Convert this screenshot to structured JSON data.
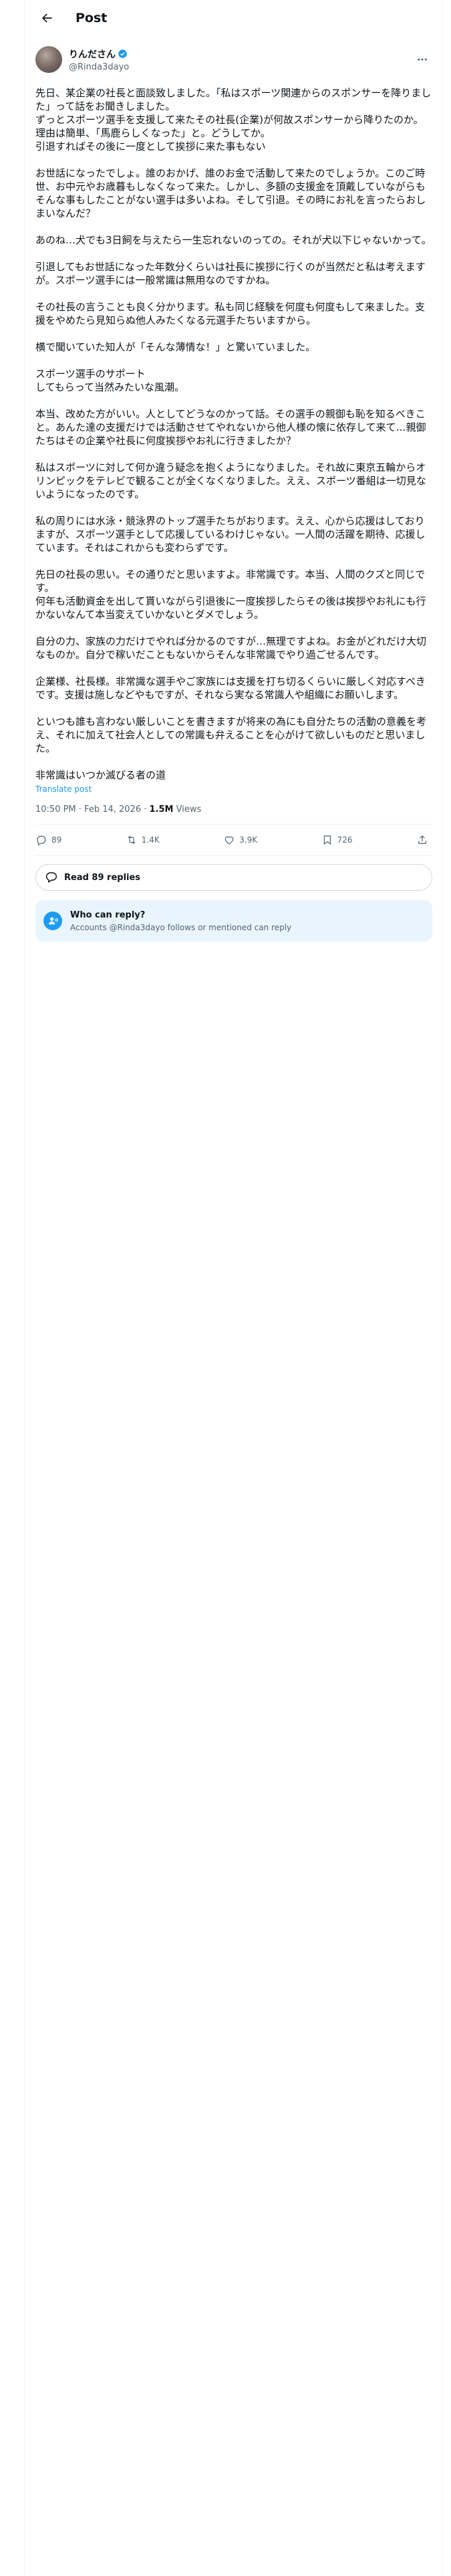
{
  "header": {
    "title": "Post"
  },
  "author": {
    "name": "りんださん",
    "handle": "@Rinda3dayo"
  },
  "post": {
    "paragraphs": [
      "先日、某企業の社長と面談致しました。「私はスポーツ関連からのスポンサーを降りました」って話をお聞きしました。\nずっとスポーツ選手を支援して来たその社長(企業)が何故スポンサーから降りたのか。理由は簡単、「馬鹿らしくなった」と。どうしてか。\n引退すればその後に一度として挨拶に来た事もない",
      "お世話になったでしょ。誰のおかげ、誰のお金で活動して来たのでしょうか。このご時世、お中元やお歳暮もしなくなって来た。しかし、多額の支援金を頂戴していながらもそんな事もしたことがない選手は多いよね。そして引退。その時にお礼を言ったらおしまいなんだ？",
      "あのね…犬でも3日飼を与えたら一生忘れないのっての。それが犬以下じゃないかって。",
      "引退してもお世話になった年数分くらいは社長に挨拶に行くのが当然だと私は考えますが。スポーツ選手には一般常識は無用なのですかね。",
      "その社長の言うことも良く分かります。私も同じ経験を何度も何度もして来ました。支援をやめたら見知らぬ他人みたくなる元選手たちいますから。",
      "横で聞いていた知人が「そんな薄情な！」と驚いていました。",
      "スポーツ選手のサポート\nしてもらって当然みたいな風潮。",
      "本当、改めた方がいい。人としてどうなのかって話。その選手の親御も恥を知るべきこと。あんた達の支援だけでは活動させてやれないから他人様の懐に依存して来て…親御たちはその企業や社長に何度挨拶やお礼に行きましたか？",
      "私はスポーツに対して何か違う疑念を抱くようになりました。それ故に東京五輪からオリンピックをテレビで観ることが全くなくなりました。ええ、スポーツ番組は一切見ないようになったのです。",
      "私の周りには水泳・競泳界のトップ選手たちがおります。ええ、心から応援はしておりますが、スポーツ選手として応援しているわけじゃない。一人間の活躍を期待、応援しています。それはこれからも変わらずです。",
      "先日の社長の思い。その通りだと思いますよ。非常識です。本当、人間のクズと同じです。\n何年も活動資金を出して貰いながら引退後に一度挨拶したらその後は挨拶やお礼にも行かないなんて本当変えていかないとダメでしょう。",
      "自分の力、家族の力だけでやれば分かるのですが…無理ですよね。お金がどれだけ大切なものか。自分で稼いだこともないからそんな非常識でやり過ごせるんです。",
      "企業様、社長様。非常識な選手やご家族には支援を打ち切るくらいに厳しく対応すべきです。支援は施しなどやもですが、それなら実なる常識人や組織にお願いします。",
      "といつも誰も言わない厳しいことを書きますが将来の為にも自分たちの活動の意義を考え、それに加えて社会人としての常識も弁えることを心がけて欲しいものだと思いました。",
      "非常識はいつか滅びる者の道"
    ],
    "translate_label": "Translate post",
    "time": "10:50 PM · Feb 14, 2026",
    "views_count": "1.5M",
    "views_label": "Views"
  },
  "actions": {
    "replies": "89",
    "reposts": "1.4K",
    "likes": "3.9K",
    "bookmarks": "726"
  },
  "read_replies_label": "Read 89 replies",
  "who_can_reply": {
    "title": "Who can reply?",
    "subtitle": "Accounts @Rinda3dayo follows or mentioned can reply"
  },
  "colors": {
    "accent": "#1d9bf0",
    "muted": "#536471",
    "text": "#0f1419"
  }
}
